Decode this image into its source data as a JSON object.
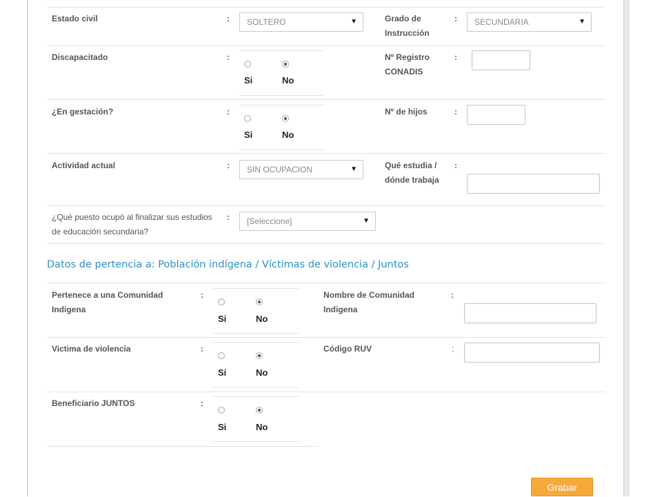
{
  "personal": {
    "estado_civil": {
      "label": "Estado civil",
      "value": "SOLTERO"
    },
    "grado_instruccion": {
      "label_line1": "Grado de",
      "label_line2": "Instrucción",
      "value": "SECUNDARIA"
    },
    "discapacitado": {
      "label": "Discapacitado",
      "selected": "No"
    },
    "registro_conadis": {
      "label_line1": "Nº Registro",
      "label_line2": "CONADIS",
      "value": ""
    },
    "gestacion": {
      "label": "¿En gestación?",
      "selected": "No"
    },
    "num_hijos": {
      "label": "Nº de hijos",
      "value": ""
    },
    "actividad_actual": {
      "label": "Actividad actual",
      "value": "SIN OCUPACION"
    },
    "que_estudia": {
      "label_line1": "Qué estudia /",
      "label_line2": "dónde trabaja",
      "value": ""
    },
    "puesto_ocupo": {
      "label_line1": "¿Qué puesto ocupó al finalizar sus estudios",
      "label_line2": "de educación secundaria?",
      "value": "[Seleccione]"
    }
  },
  "section_title": "Datos de pertencia a: Población indígena / Víctimas de violencia / Juntos",
  "pertenencia": {
    "comunidad_indigena": {
      "label_line1": "Pertenece a una Comunidad",
      "label_line2": "Indigena",
      "selected": "No"
    },
    "nombre_comunidad": {
      "label_line1": "Nombre de Comunidad",
      "label_line2": "Indigena",
      "value": ""
    },
    "victima_violencia": {
      "label": "Victima de violencia",
      "selected": "No"
    },
    "codigo_ruv": {
      "label": "Código RUV",
      "value": ""
    },
    "beneficiario_juntos": {
      "label": "Beneficiario JUNTOS",
      "selected": "No"
    }
  },
  "common": {
    "colon": ":",
    "si": "Si",
    "no": "No",
    "caret": "▼"
  },
  "actions": {
    "save_label": "Grabar"
  },
  "colors": {
    "accent": "#2f8fc4",
    "button": "#f7a83b"
  }
}
